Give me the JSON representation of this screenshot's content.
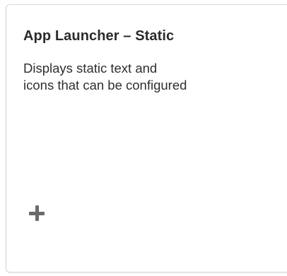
{
  "card": {
    "title": "App Launcher – Static",
    "description_lines": [
      "Displays static text and",
      "icons that can be configured"
    ],
    "add_icon": "plus-icon"
  }
}
